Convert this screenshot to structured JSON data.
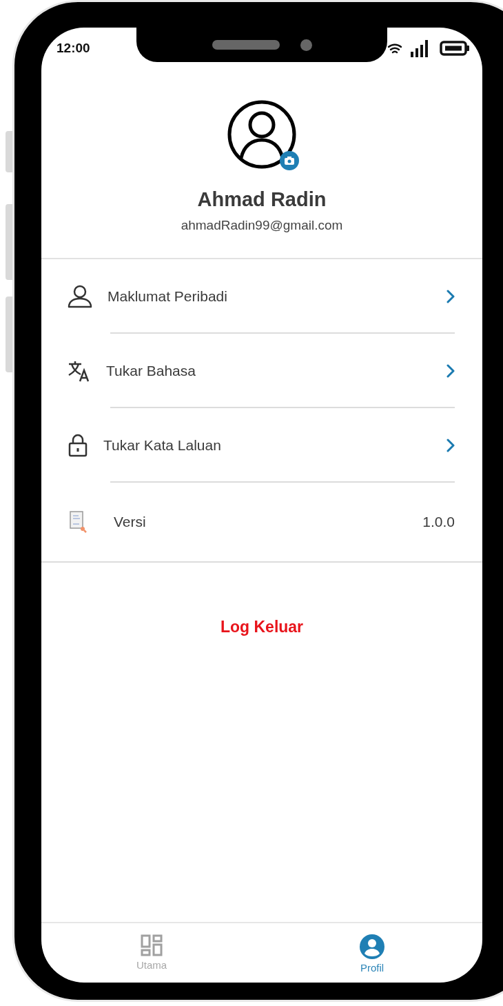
{
  "status_bar": {
    "time": "12:00"
  },
  "profile": {
    "name": "Ahmad Radin",
    "email": "ahmadRadin99@gmail.com"
  },
  "menu": [
    {
      "kind": "link",
      "label": "Maklumat Peribadi"
    },
    {
      "kind": "link",
      "label": "Tukar Bahasa"
    },
    {
      "kind": "link",
      "label": "Tukar Kata Laluan"
    },
    {
      "kind": "info",
      "label": "Versi",
      "value": "1.0.0"
    }
  ],
  "logout": "Log Keluar",
  "nav": [
    {
      "label": "Utama",
      "selected": false
    },
    {
      "label": "Profil",
      "selected": true
    }
  ]
}
